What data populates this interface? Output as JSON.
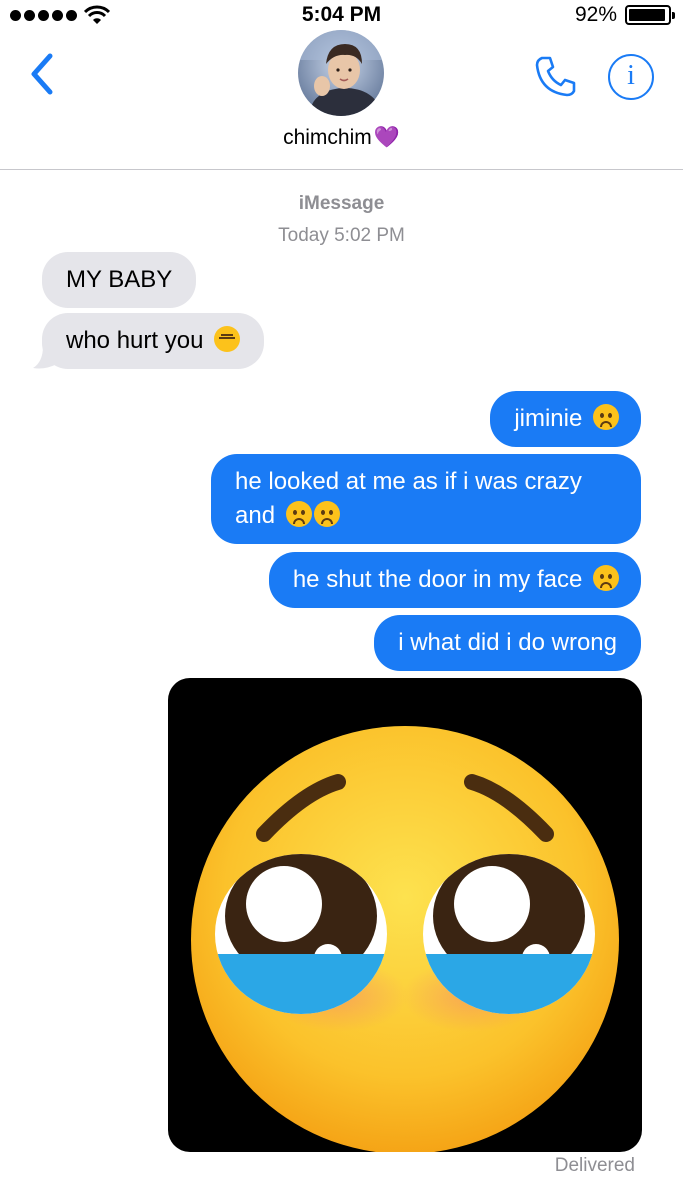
{
  "status_bar": {
    "time": "5:04 PM",
    "battery_percent": "92%",
    "battery_level": 0.92,
    "signal_icon": "signal-dots-icon",
    "wifi_icon": "wifi-icon"
  },
  "header": {
    "back_icon": "chevron-left-icon",
    "contact_name": "chimchim",
    "contact_emoji": "💜",
    "call_icon": "phone-icon",
    "info_icon": "info-icon",
    "info_glyph": "i"
  },
  "conversation": {
    "service": "iMessage",
    "timestamp": "Today 5:02 PM",
    "incoming": [
      {
        "text": "MY BABY"
      },
      {
        "text": "who hurt you",
        "emoji": "expressionless-face"
      }
    ],
    "outgoing": [
      {
        "text": "jiminie",
        "emoji": "frowning-face"
      },
      {
        "text_line1": "he looked at me as if i was crazy",
        "text_line2": "and",
        "emoji": "frowning-face-x2"
      },
      {
        "text": "he shut the door in my face",
        "emoji": "frowning-face"
      },
      {
        "text": "i what did i do wrong"
      }
    ],
    "image_message": "pleading-face-emoji-image",
    "delivery_status": "Delivered"
  },
  "colors": {
    "accent": "#1a7bf5",
    "incoming_bubble": "#e5e5ea",
    "meta_text": "#8e8e93",
    "heart": "#a246d8"
  }
}
